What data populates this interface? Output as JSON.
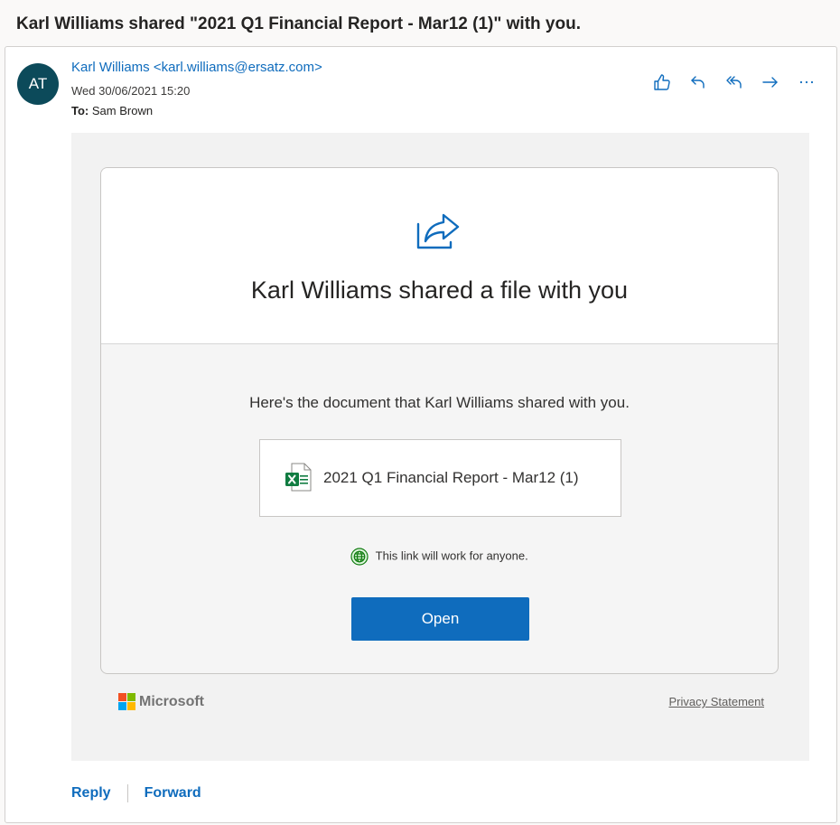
{
  "subject": "Karl Williams shared \"2021 Q1 Financial Report - Mar12 (1)\" with you.",
  "message": {
    "avatar_initials": "AT",
    "sender": "Karl Williams <karl.williams@ersatz.com>",
    "date": "Wed 30/06/2021 15:20",
    "to_label": "To:",
    "to_value": "Sam Brown",
    "actions": [
      "like-icon",
      "reply-icon",
      "reply-all-icon",
      "forward-icon",
      "more-icon"
    ]
  },
  "share": {
    "icon": "share-icon",
    "title": "Karl Williams shared a file with you",
    "description": "Here's the document that Karl Williams shared with you.",
    "file_icon": "excel-file-icon",
    "file_name": "2021 Q1 Financial Report - Mar12 (1)",
    "link_note": "This link will work for anyone.",
    "open_label": "Open",
    "brand": "Microsoft",
    "privacy_label": "Privacy Statement"
  },
  "footer": {
    "reply_label": "Reply",
    "forward_label": "Forward"
  },
  "colors": {
    "accent": "#0f6cbd",
    "avatar": "#0c4a5a",
    "excel_green": "#107c41",
    "globe_green": "#107c10"
  }
}
